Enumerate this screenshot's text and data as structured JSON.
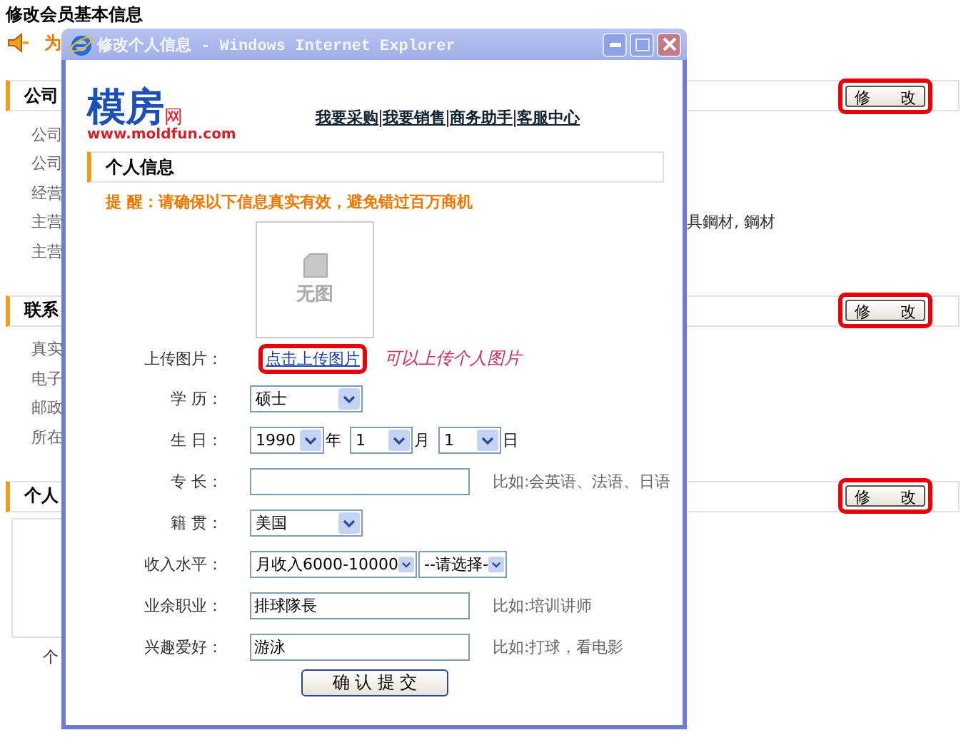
{
  "page_title": "修改会员基本信息",
  "notice": {
    "text": "为"
  },
  "sections": [
    {
      "title": "公司",
      "button": {
        "label": "修 改",
        "highlighted": true
      },
      "rows": [
        {
          "label": "公司"
        },
        {
          "label": "公司"
        },
        {
          "label": "经营"
        },
        {
          "label": "主营",
          "value": "具鋼材, 鋼材"
        },
        {
          "label": "主营"
        }
      ]
    },
    {
      "title": "联系",
      "button": {
        "label": "修 改",
        "highlighted": true
      },
      "rows": [
        {
          "label": "真实"
        },
        {
          "label": "电子"
        },
        {
          "label": "邮政"
        },
        {
          "label": "所在"
        }
      ]
    },
    {
      "title": "个人",
      "button": {
        "label": "修 改",
        "highlighted": true
      },
      "card": true,
      "caption": "个"
    }
  ],
  "popup": {
    "title": "修改个人信息 - Windows Internet Explorer",
    "logo": {
      "name": "模房",
      "suffix": "网",
      "url": "www.moldfun.com"
    },
    "nav": [
      "我要采购",
      "我要销售",
      "商务助手",
      "客服中心"
    ],
    "section_title": "个人信息",
    "reminder": "提 醒：请确保以下信息真实有效，避免错过百万商机",
    "photo_placeholder": "无图",
    "fields": [
      {
        "kind": "upload",
        "label": "上传图片：",
        "link": "点击上传图片",
        "highlighted": true,
        "note": "可以上传个人图片"
      },
      {
        "kind": "select",
        "label": "学 历：",
        "value": "硕士"
      },
      {
        "kind": "date",
        "label": "生 日：",
        "parts": [
          {
            "value": "1990",
            "unit": "年"
          },
          {
            "value": "1",
            "unit": "月"
          },
          {
            "value": "1",
            "unit": "日"
          }
        ]
      },
      {
        "kind": "text",
        "label": "专 长：",
        "hint": "比如:会英语、法语、日语"
      },
      {
        "kind": "select",
        "label": "籍 贯：",
        "value": "美国"
      },
      {
        "kind": "income",
        "label": "收入水平：",
        "value": "月收入6000-10000",
        "extra": "--请选择-"
      },
      {
        "kind": "text",
        "label": "业余职业：",
        "value": "排球隊長",
        "hint": "比如:培训讲师"
      },
      {
        "kind": "text",
        "label": "兴趣爱好：",
        "value": "游泳",
        "hint": "比如:打球，看电影"
      }
    ],
    "submit": "确 认 提 交"
  }
}
